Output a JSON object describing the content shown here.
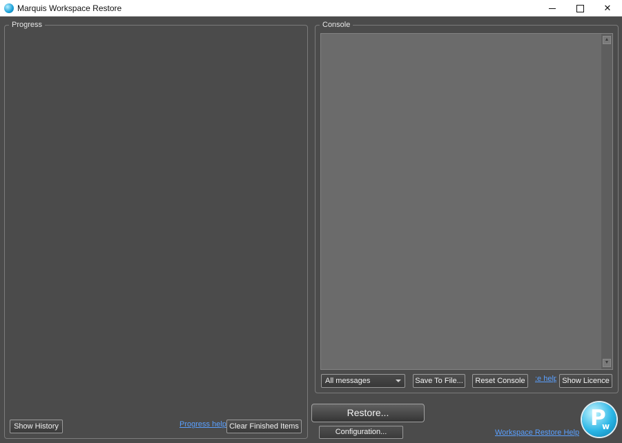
{
  "window": {
    "title": "Marquis Workspace Restore"
  },
  "progress": {
    "group_title": "Progress",
    "show_history_label": "Show History",
    "help_link": "Progress help",
    "clear_label": "Clear Finished Items"
  },
  "console": {
    "group_title": "Console",
    "filter_selected": "All messages",
    "save_label": "Save To File...",
    "reset_label": "Reset Console",
    "help_link": "Console help",
    "help_link_visible": ":e help",
    "licence_label": "Show Licence"
  },
  "actions": {
    "restore_label": "Restore...",
    "config_label": "Configuration...",
    "help_link": "Workspace Restore Help"
  },
  "logo": {
    "letter_main": "P",
    "letter_sub": "w"
  },
  "colors": {
    "background": "#4b4b4b",
    "console_area": "#6b6b6b",
    "link": "#5aa0ff",
    "logo_accent": "#2bb6e6"
  },
  "icons": {
    "app": "marquis-app-icon",
    "minimize": "minimize-icon",
    "maximize": "maximize-icon",
    "close": "close-icon",
    "dropdown": "chevron-down-icon"
  }
}
